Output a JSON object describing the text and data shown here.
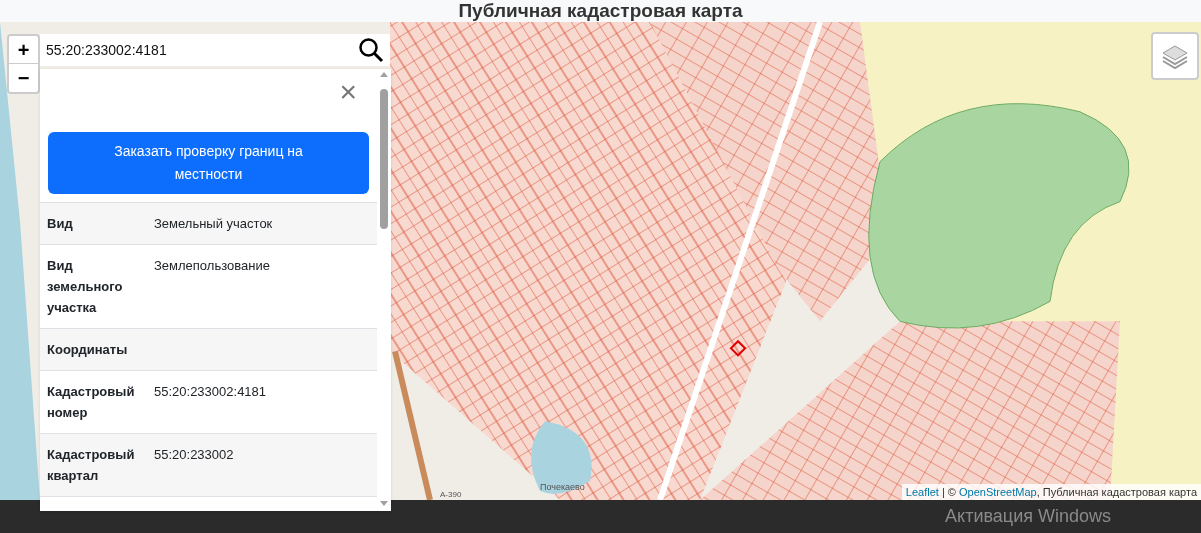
{
  "header": {
    "title": "Публичная кадастровая карта"
  },
  "search": {
    "value": "55:20:233002:4181"
  },
  "zoom": {
    "in": "+",
    "out": "−"
  },
  "panel": {
    "close": "×",
    "order_button": "Заказать проверку границ на местности",
    "rows": [
      {
        "label": "Вид",
        "value": "Земельный участок"
      },
      {
        "label": "Вид земельного участка",
        "value": "Землепользование"
      },
      {
        "label": "Координаты"
      },
      {
        "label": "Кадастровый номер",
        "value": "55:20:233002:4181"
      },
      {
        "label": "Кадастровый квартал",
        "value": "55:20:233002"
      }
    ]
  },
  "map": {
    "place_label": "Почекаево",
    "road_label": "А-390"
  },
  "attribution": {
    "leaflet": "Leaflet",
    "separator": "|",
    "copyright": "©",
    "osm": "OpenStreetMap",
    "layer": ", Публичная кадастровая карта"
  },
  "footer": {
    "notice": "Активация Windows"
  }
}
